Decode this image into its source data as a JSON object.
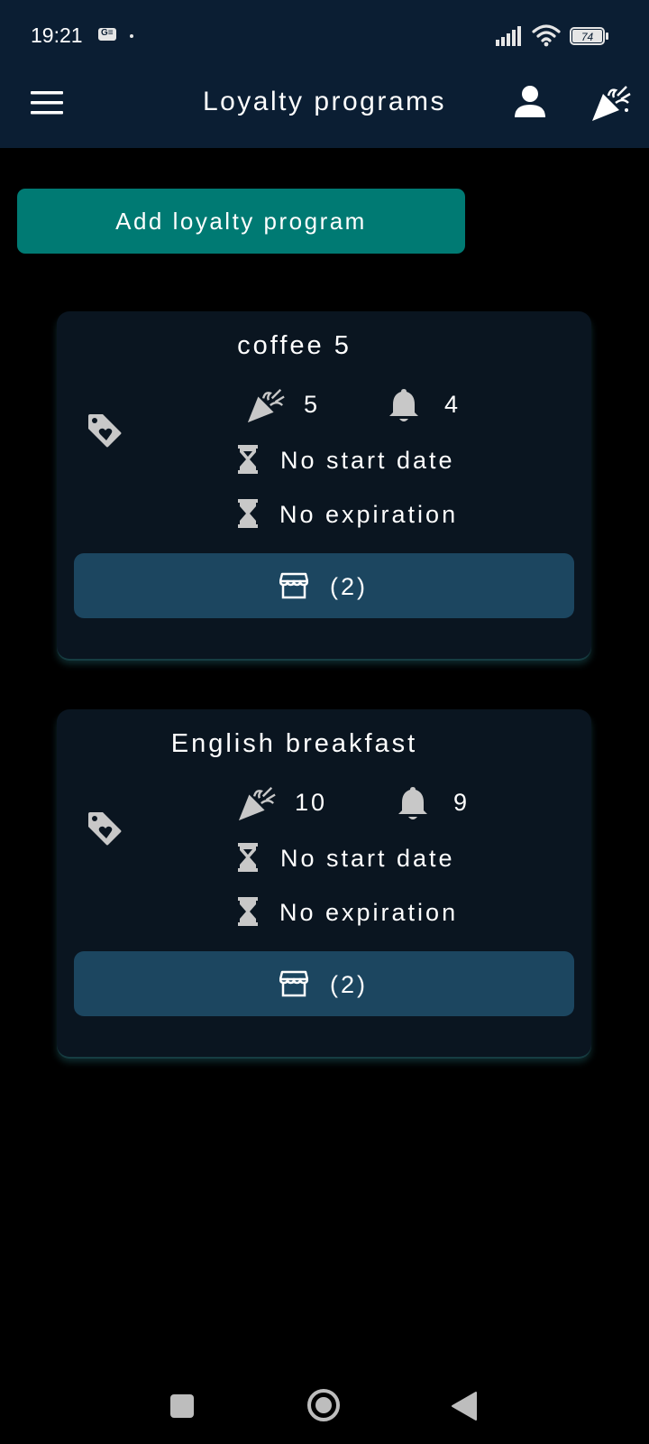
{
  "status_bar": {
    "time": "19:21",
    "g_icon": "G≡",
    "battery": "74"
  },
  "app_bar": {
    "title": "Loyalty programs"
  },
  "add_button_label": "Add loyalty program",
  "programs": [
    {
      "name": "coffee 5",
      "required": "5",
      "reminder": "4",
      "start": "No start date",
      "expiration": "No expiration",
      "stores": "(2)"
    },
    {
      "name": "English breakfast",
      "required": "10",
      "reminder": "9",
      "start": "No start date",
      "expiration": "No expiration",
      "stores": "(2)"
    }
  ],
  "icons": {
    "menu": "menu-icon",
    "account": "person-icon",
    "rewards": "party-popper-icon",
    "program": "tag-heart-icon",
    "goal": "party-popper-icon",
    "reminder": "bell-icon",
    "date": "hourglass-icon",
    "stores": "store-icon"
  },
  "colors": {
    "app_bar": "#0b1e33",
    "primary": "#007a73",
    "card": "#0a1520",
    "store_button": "#1c4660",
    "icon_grey": "#c8c8c8"
  }
}
